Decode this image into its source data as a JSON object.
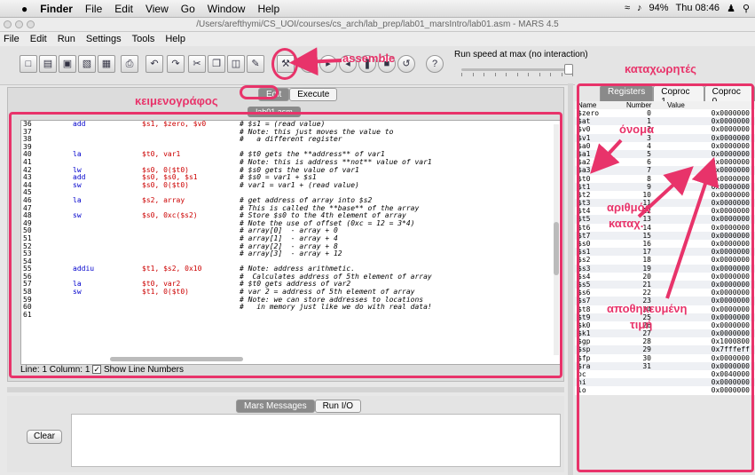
{
  "system_menu": {
    "app": "Finder",
    "items": [
      "File",
      "Edit",
      "View",
      "Go",
      "Window",
      "Help"
    ],
    "battery": "94%",
    "clock": "Thu 08:46"
  },
  "window": {
    "title": "/Users/arefthymi/CS_UOI/courses/cs_arch/lab_prep/lab01_marsIntro/lab01.asm  - MARS 4.5"
  },
  "app_menu": [
    "File",
    "Edit",
    "Run",
    "Settings",
    "Tools",
    "Help"
  ],
  "toolbar": {
    "run_speed_label": "Run speed at max (no interaction)",
    "run_speed_fraction": 1.0
  },
  "editor": {
    "tabs": {
      "edit": "Edit",
      "execute": "Execute"
    },
    "file_tab": "lab01.asm",
    "lines": [
      {
        "n": "36",
        "op": "add",
        "args": "$s1, $zero, $v0",
        "comment": "# $s1 = (read value)"
      },
      {
        "n": "37",
        "op": "",
        "args": "",
        "comment": "# Note: this just moves the value to"
      },
      {
        "n": "38",
        "op": "",
        "args": "",
        "comment": "#   a different register"
      },
      {
        "n": "39",
        "op": "",
        "args": "",
        "comment": ""
      },
      {
        "n": "40",
        "op": "la",
        "args": "$t0, var1",
        "comment": "# $t0 gets the **address** of var1"
      },
      {
        "n": "41",
        "op": "",
        "args": "",
        "comment": "# Note: this is address **not** value of var1"
      },
      {
        "n": "42",
        "op": "lw",
        "args": "$s0, 0($t0)",
        "comment": "# $s0 gets the value of var1"
      },
      {
        "n": "43",
        "op": "add",
        "args": "$s0, $s0, $s1",
        "comment": "# $s0 = var1 + $s1"
      },
      {
        "n": "44",
        "op": "sw",
        "args": "$s0, 0($t0)",
        "comment": "# var1 = var1 + (read value)"
      },
      {
        "n": "45",
        "op": "",
        "args": "",
        "comment": ""
      },
      {
        "n": "46",
        "op": "la",
        "args": "$s2, array",
        "comment": "# get address of array into $s2"
      },
      {
        "n": "47",
        "op": "",
        "args": "",
        "comment": "# This is called the **base** of the array"
      },
      {
        "n": "48",
        "op": "sw",
        "args": "$s0, 0xc($s2)",
        "comment": "# Store $s0 to the 4th element of array"
      },
      {
        "n": "49",
        "op": "",
        "args": "",
        "comment": "# Note the use of offset (0xc = 12 = 3*4)"
      },
      {
        "n": "50",
        "op": "",
        "args": "",
        "comment": "# array[0]  - array + 0"
      },
      {
        "n": "51",
        "op": "",
        "args": "",
        "comment": "# array[1]  - array + 4"
      },
      {
        "n": "52",
        "op": "",
        "args": "",
        "comment": "# array[2]  - array + 8"
      },
      {
        "n": "53",
        "op": "",
        "args": "",
        "comment": "# array[3]  - array + 12"
      },
      {
        "n": "54",
        "op": "",
        "args": "",
        "comment": ""
      },
      {
        "n": "55",
        "op": "addiu",
        "args": "$t1, $s2, 0x10",
        "comment": "# Note: address arithmetic."
      },
      {
        "n": "56",
        "op": "",
        "args": "",
        "comment": "#  Calculates address of 5th element of array"
      },
      {
        "n": "57",
        "op": "la",
        "args": "$t0, var2",
        "comment": "# $t0 gets address of var2"
      },
      {
        "n": "58",
        "op": "sw",
        "args": "$t1, 0($t0)",
        "comment": "# var 2 = address of 5th element of array"
      },
      {
        "n": "59",
        "op": "",
        "args": "",
        "comment": "# Note: we can store addresses to locations"
      },
      {
        "n": "60",
        "op": "",
        "args": "",
        "comment": "#   in memory just like we do with real data!"
      },
      {
        "n": "61",
        "op": "",
        "args": "",
        "comment": ""
      }
    ],
    "status": "Line: 1 Column: 1",
    "show_line_numbers": "Show Line Numbers"
  },
  "messages": {
    "tabs": {
      "mars": "Mars Messages",
      "runio": "Run I/O"
    },
    "clear": "Clear"
  },
  "registers": {
    "tabs": [
      "Registers",
      "Coproc 1",
      "Coproc 0"
    ],
    "headers": [
      "Name",
      "Number",
      "Value"
    ],
    "rows": [
      [
        "$zero",
        "0",
        "0x0000000"
      ],
      [
        "$at",
        "1",
        "0x0000000"
      ],
      [
        "$v0",
        "2",
        "0x0000000"
      ],
      [
        "$v1",
        "3",
        "0x0000000"
      ],
      [
        "$a0",
        "4",
        "0x0000000"
      ],
      [
        "$a1",
        "5",
        "0x0000000"
      ],
      [
        "$a2",
        "6",
        "0x0000000"
      ],
      [
        "$a3",
        "7",
        "0x0000000"
      ],
      [
        "$t0",
        "8",
        "0x0000000"
      ],
      [
        "$t1",
        "9",
        "0x0000000"
      ],
      [
        "$t2",
        "10",
        "0x0000000"
      ],
      [
        "$t3",
        "11",
        "0x0000000"
      ],
      [
        "$t4",
        "12",
        "0x0000000"
      ],
      [
        "$t5",
        "13",
        "0x0000000"
      ],
      [
        "$t6",
        "14",
        "0x0000000"
      ],
      [
        "$t7",
        "15",
        "0x0000000"
      ],
      [
        "$s0",
        "16",
        "0x0000000"
      ],
      [
        "$s1",
        "17",
        "0x0000000"
      ],
      [
        "$s2",
        "18",
        "0x0000000"
      ],
      [
        "$s3",
        "19",
        "0x0000000"
      ],
      [
        "$s4",
        "20",
        "0x0000000"
      ],
      [
        "$s5",
        "21",
        "0x0000000"
      ],
      [
        "$s6",
        "22",
        "0x0000000"
      ],
      [
        "$s7",
        "23",
        "0x0000000"
      ],
      [
        "$t8",
        "24",
        "0x0000000"
      ],
      [
        "$t9",
        "25",
        "0x0000000"
      ],
      [
        "$k0",
        "26",
        "0x0000000"
      ],
      [
        "$k1",
        "27",
        "0x0000000"
      ],
      [
        "$gp",
        "28",
        "0x1000800"
      ],
      [
        "$sp",
        "29",
        "0x7fffeff"
      ],
      [
        "$fp",
        "30",
        "0x0000000"
      ],
      [
        "$ra",
        "31",
        "0x0000000"
      ],
      [
        "pc",
        "",
        "0x0040000"
      ],
      [
        "hi",
        "",
        "0x0000000"
      ],
      [
        "lo",
        "",
        "0x0000000"
      ]
    ]
  },
  "annotations": {
    "assemble": "assemble",
    "registers": "καταχωρητές",
    "editor": "κειμενογράφος",
    "name": "όνομα",
    "number1": "αριθμός",
    "number2": "καταχ.",
    "stored1": "αποθηκευμένη",
    "stored2": "τιμή",
    "accent_color": "#e8336a"
  }
}
